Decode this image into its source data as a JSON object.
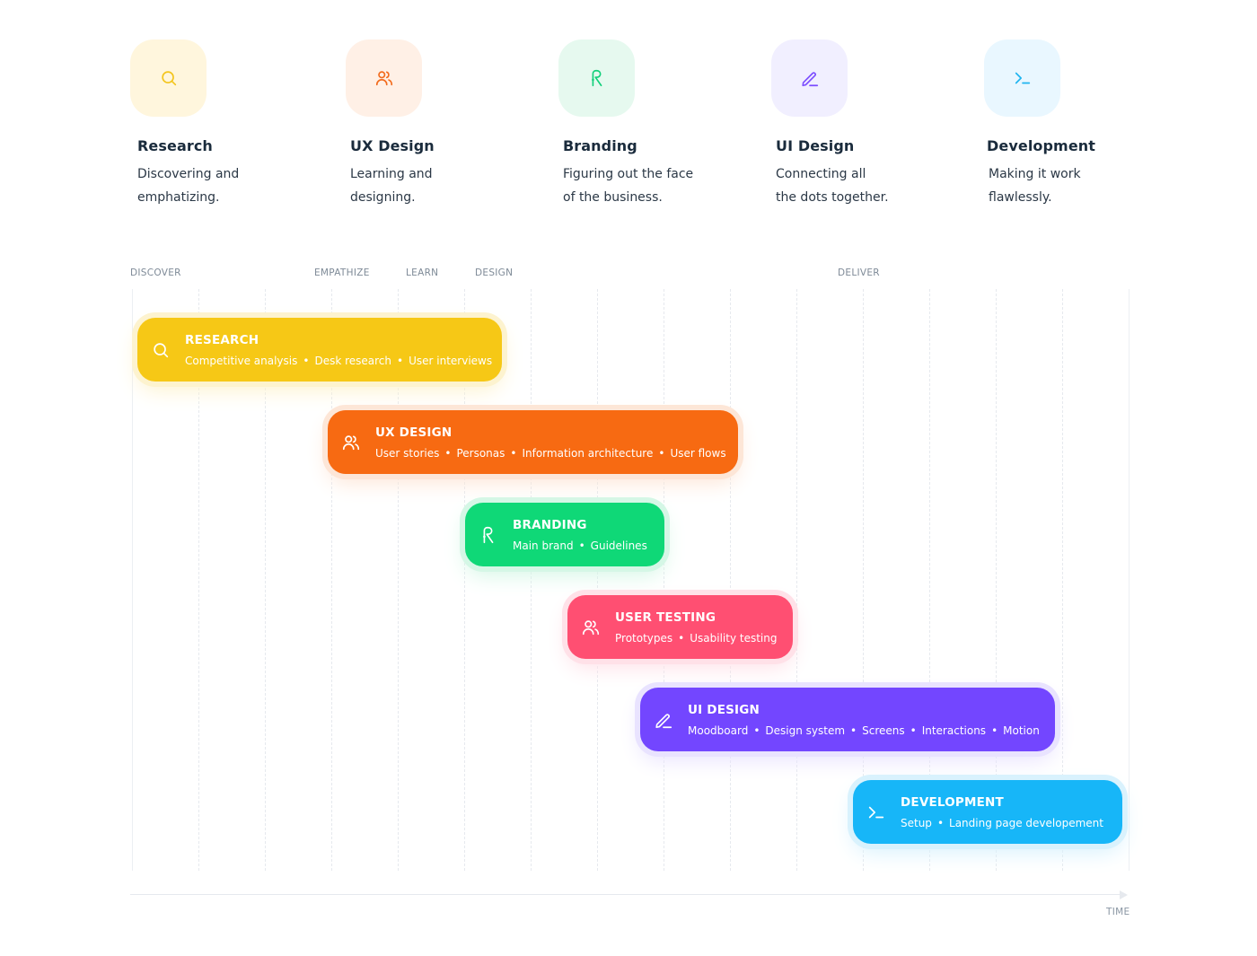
{
  "phases": [
    {
      "title": "Research",
      "desc1": "Discovering and",
      "desc2": "emphatizing.",
      "icon": "search-icon",
      "tile_color": "#fff6dd",
      "icon_color": "#f3c51e"
    },
    {
      "title": "UX Design",
      "desc1": "Learning and",
      "desc2": "designing.",
      "icon": "users-icon",
      "tile_color": "#fff0e6",
      "icon_color": "#f26b1d"
    },
    {
      "title": "Branding",
      "desc1": "Figuring out the face",
      "desc2": "of the business.",
      "icon": "brand-r-icon",
      "tile_color": "#e6f9ef",
      "icon_color": "#11d07a"
    },
    {
      "title": "UI Design",
      "desc1": "Connecting all",
      "desc2": "the dots together.",
      "icon": "pen-icon",
      "tile_color": "#f1efff",
      "icon_color": "#7c4dff"
    },
    {
      "title": "Development",
      "desc1": "Making it work",
      "desc2": "flawlessly.",
      "icon": "terminal-icon",
      "tile_color": "#e9f7ff",
      "icon_color": "#1eb4f0"
    }
  ],
  "stages": [
    "DISCOVER",
    "EMPATHIZE",
    "LEARN",
    "DESIGN",
    "DELIVER"
  ],
  "bars": [
    {
      "title": "RESEARCH",
      "items": [
        "Competitive analysis",
        "Desk research",
        "User interviews"
      ],
      "icon": "search-icon",
      "color": "#f6c816",
      "halo": "#fdf3cf"
    },
    {
      "title": "UX DESIGN",
      "items": [
        "User stories",
        "Personas",
        "Information architecture",
        "User flows"
      ],
      "icon": "users-icon",
      "color": "#f76a12",
      "halo": "#fde6d7"
    },
    {
      "title": "BRANDING",
      "items": [
        "Main brand",
        "Guidelines"
      ],
      "icon": "brand-r-icon",
      "color": "#0fd877",
      "halo": "#d5f7e6"
    },
    {
      "title": "USER TESTING",
      "items": [
        "Prototypes",
        "Usability testing"
      ],
      "icon": "users-icon",
      "color": "#ff4f72",
      "halo": "#ffe1e8"
    },
    {
      "title": "UI DESIGN",
      "items": [
        "Moodboard",
        "Design system",
        "Screens",
        "Interactions",
        "Motion"
      ],
      "icon": "pen-icon",
      "color": "#7346ff",
      "halo": "#e9e3ff"
    },
    {
      "title": "DEVELOPMENT",
      "items": [
        "Setup",
        "Landing page developement"
      ],
      "icon": "terminal-icon",
      "color": "#17b6f8",
      "halo": "#d9f2fd"
    }
  ],
  "axis_label": "TIME"
}
